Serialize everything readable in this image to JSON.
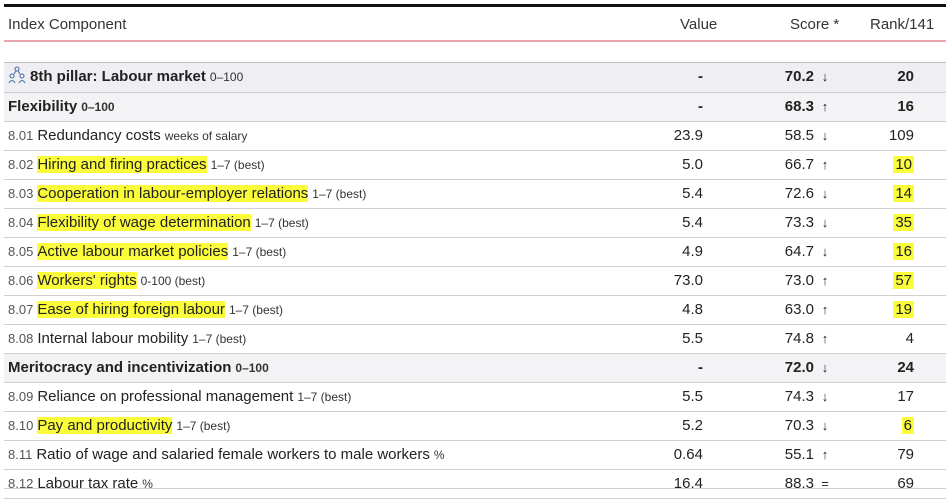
{
  "header": {
    "component": "Index Component",
    "value": "Value",
    "score": "Score *",
    "rank": "Rank/141"
  },
  "pillar": {
    "icon": "people-network-icon",
    "label": "8th pillar: Labour market",
    "unit": "0–100",
    "value": "-",
    "score": "70.2",
    "arrow": "↓",
    "rank": "20"
  },
  "rows": [
    {
      "type": "sub",
      "num": "",
      "label": "Flexibility",
      "unit": "0–100",
      "value": "-",
      "score": "68.3",
      "arrow": "↑",
      "rank": "16",
      "highlight": false
    },
    {
      "type": "item",
      "num": "8.01",
      "label": "Redundancy costs",
      "unit": "weeks of salary",
      "value": "23.9",
      "score": "58.5",
      "arrow": "↓",
      "rank": "109",
      "highlight": false
    },
    {
      "type": "item",
      "num": "8.02",
      "label": "Hiring and firing practices",
      "unit": "1–7 (best)",
      "value": "5.0",
      "score": "66.7",
      "arrow": "↑",
      "rank": "10",
      "highlight": true
    },
    {
      "type": "item",
      "num": "8.03",
      "label": "Cooperation in labour-employer relations",
      "unit": "1–7 (best)",
      "value": "5.4",
      "score": "72.6",
      "arrow": "↓",
      "rank": "14",
      "highlight": true
    },
    {
      "type": "item",
      "num": "8.04",
      "label": "Flexibility of wage determination",
      "unit": "1–7 (best)",
      "value": "5.4",
      "score": "73.3",
      "arrow": "↓",
      "rank": "35",
      "highlight": true
    },
    {
      "type": "item",
      "num": "8.05",
      "label": "Active labour market policies",
      "unit": "1–7 (best)",
      "value": "4.9",
      "score": "64.7",
      "arrow": "↓",
      "rank": "16",
      "highlight": true
    },
    {
      "type": "item",
      "num": "8.06",
      "label": "Workers' rights",
      "unit": "0-100 (best)",
      "value": "73.0",
      "score": "73.0",
      "arrow": "↑",
      "rank": "57",
      "highlight": true
    },
    {
      "type": "item",
      "num": "8.07",
      "label": "Ease of hiring foreign labour",
      "unit": "1–7 (best)",
      "value": "4.8",
      "score": "63.0",
      "arrow": "↑",
      "rank": "19",
      "highlight": true
    },
    {
      "type": "item",
      "num": "8.08",
      "label": "Internal labour mobility",
      "unit": "1–7 (best)",
      "value": "5.5",
      "score": "74.8",
      "arrow": "↑",
      "rank": "4",
      "highlight": false
    },
    {
      "type": "sub",
      "num": "",
      "label": "Meritocracy and incentivization",
      "unit": "0–100",
      "value": "-",
      "score": "72.0",
      "arrow": "↓",
      "rank": "24",
      "highlight": false
    },
    {
      "type": "item",
      "num": "8.09",
      "label": "Reliance on professional management",
      "unit": "1–7 (best)",
      "value": "5.5",
      "score": "74.3",
      "arrow": "↓",
      "rank": "17",
      "highlight": false
    },
    {
      "type": "item",
      "num": "8.10",
      "label": "Pay and productivity",
      "unit": "1–7 (best)",
      "value": "5.2",
      "score": "70.3",
      "arrow": "↓",
      "rank": "6",
      "highlight": true
    },
    {
      "type": "item",
      "num": "8.11",
      "label": "Ratio of wage and salaried female workers to male workers",
      "unit": "%",
      "value": "0.64",
      "score": "55.1",
      "arrow": "↑",
      "rank": "79",
      "highlight": false
    },
    {
      "type": "item",
      "num": "8.12",
      "label": "Labour tax rate",
      "unit": "%",
      "value": "16.4",
      "score": "88.3",
      "arrow": "=",
      "rank": "69",
      "highlight": false
    }
  ]
}
